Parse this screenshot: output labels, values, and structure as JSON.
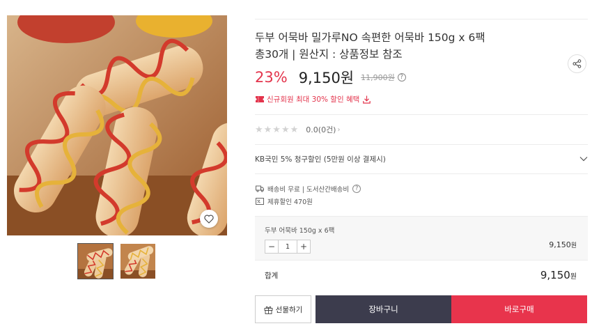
{
  "product": {
    "title_line1": "두부 어묵바 밀가루NO 속편한 어묵바 150g x 6팩",
    "title_line2": "총30개 | 원산지 : 상품정보 참조"
  },
  "price": {
    "discount_rate": "23%",
    "sale_price": "9,150원",
    "original_price": "11,900원",
    "help_icon": "?"
  },
  "coupon": {
    "icon": "ticket-icon",
    "text": "신규회원 최대 30% 할인 혜택",
    "download_icon": "download-icon"
  },
  "rating": {
    "stars": "★★★★★",
    "score_text": "0.0(0건)",
    "chevron": "›",
    "rating_value": 0
  },
  "card_promo": {
    "text": "KB국민 5% 청구할인 (5만원 이상 결제시)",
    "chevron_icon": "chevron-down-icon"
  },
  "shipping": {
    "text": "배송비 무료 | 도서산간배송비",
    "help_icon": "?"
  },
  "partner": {
    "text": "제휴할인 470원"
  },
  "option": {
    "name": "두부 어묵바 150g x 6팩",
    "minus": "−",
    "quantity": "1",
    "plus": "+",
    "price_number": "9,150",
    "price_unit": "원"
  },
  "total": {
    "label": "합계",
    "price_number": "9,150",
    "price_unit": "원"
  },
  "buttons": {
    "gift": "선물하기",
    "cart": "장바구니",
    "buy": "바로구매"
  },
  "colors": {
    "accent_red": "#e3344c",
    "cart_button": "#3c3c4d",
    "buy_button": "#e8344c"
  }
}
